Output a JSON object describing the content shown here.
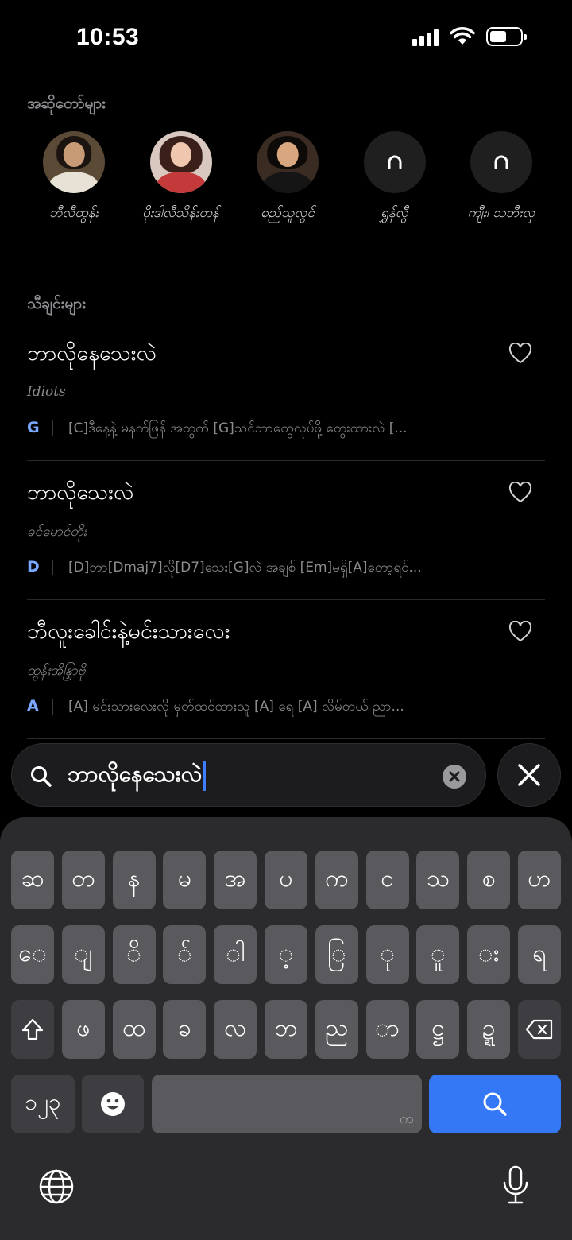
{
  "status": {
    "time": "10:53"
  },
  "artists_section": {
    "label": "အဆိုတော်များ",
    "items": [
      {
        "name": "ဘီလီထွန်း",
        "has_photo": true
      },
      {
        "name": "ပိုးဒါလီသိန်းတန်",
        "has_photo": true
      },
      {
        "name": "စည်သူလွင်",
        "has_photo": true
      },
      {
        "name": "ရွှန်လွီ",
        "has_photo": false
      },
      {
        "name": "ကျီး၊ သဘီးလှ",
        "has_photo": false
      }
    ]
  },
  "songs_section": {
    "label": "သီချင်းများ",
    "items": [
      {
        "title": "ဘာလိုနေသေးလဲ",
        "artist": "Idiots",
        "key": "G",
        "lyrics": "[C]ဒီနေ့နဲ့ မနက်ဖြန် အတွက် [G]သင်ဘာတွေလုပ်ဖို့ တွေးထားလဲ [..."
      },
      {
        "title": "ဘာလိုသေးလဲ",
        "artist": "ခင်မောင်တိုး",
        "key": "D",
        "lyrics": "[D]ဘာ[Dmaj7]လို[D7]သေး[G]လဲ အချစ် [Em]မရှိ[A]တော့ရင်..."
      },
      {
        "title": "ဘီလူးခေါင်းနဲ့မင်းသားလေး",
        "artist": "ထွန်းအိန္ဒြာဗို",
        "key": "A",
        "lyrics": "[A] မင်းသားလေးလို မှတ်ထင်ထားသူ [A] ရေ [A] လိမ်တယ် ညာ..."
      }
    ]
  },
  "search": {
    "value": "ဘာလိုနေသေးလဲ"
  },
  "keyboard": {
    "row1": [
      "ဆ",
      "တ",
      "န",
      "မ",
      "အ",
      "ပ",
      "က",
      "င",
      "သ",
      "စ",
      "ဟ"
    ],
    "row2": [
      "ေ",
      "ျ",
      "ိ",
      "်",
      "ါ",
      "့",
      "ြ",
      "ု",
      "ူ",
      "း",
      "ရ"
    ],
    "row3": [
      "ဖ",
      "ထ",
      "ခ",
      "လ",
      "ဘ",
      "ည",
      "ာ",
      "ဋ္ဌ",
      "ဍ္ဍ"
    ],
    "numbers_label": "၁၂၃",
    "space_sub": "က"
  },
  "colors": {
    "accent": "#3478f6",
    "key_badge": "#7aa7ff"
  }
}
